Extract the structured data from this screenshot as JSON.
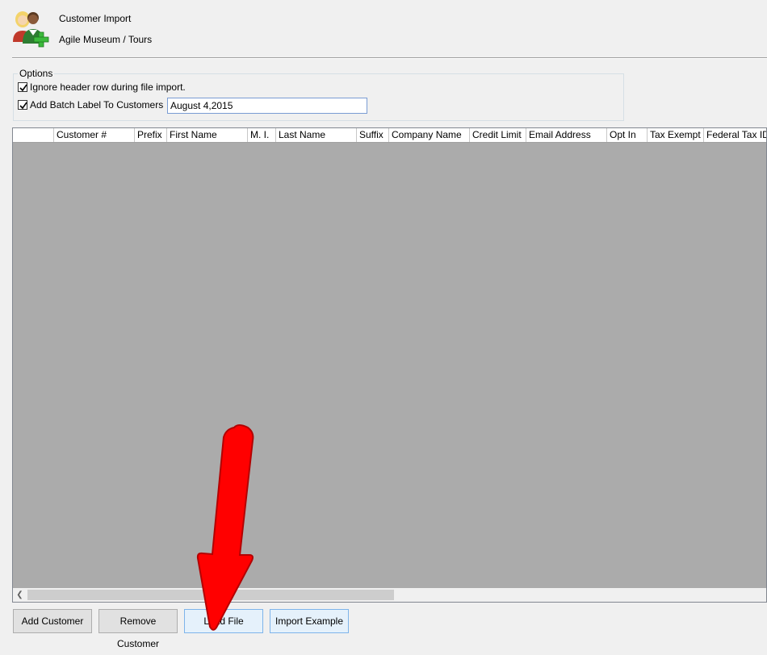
{
  "header": {
    "title": "Customer Import",
    "subtitle": "Agile Museum / Tours",
    "icon": "customers-add-icon"
  },
  "options": {
    "legend": "Options",
    "ignore_header": {
      "label": "Ignore header row during file import.",
      "checked": true
    },
    "batch_label": {
      "label": "Add Batch Label To Customers",
      "checked": true,
      "value": "August 4,2015"
    }
  },
  "grid": {
    "columns": [
      "",
      "Customer #",
      "Prefix",
      "First Name",
      "M. I.",
      "Last Name",
      "Suffix",
      "Company Name",
      "Credit Limit",
      "Email Address",
      "Opt In",
      "Tax Exempt",
      "Federal Tax ID"
    ],
    "rows": []
  },
  "buttons": {
    "add": "Add Customer",
    "remove": "Remove Customer",
    "load": "Load File",
    "example": "Import Example"
  },
  "colors": {
    "annotation_arrow": "#ff0000",
    "grid_background": "#ababab"
  }
}
